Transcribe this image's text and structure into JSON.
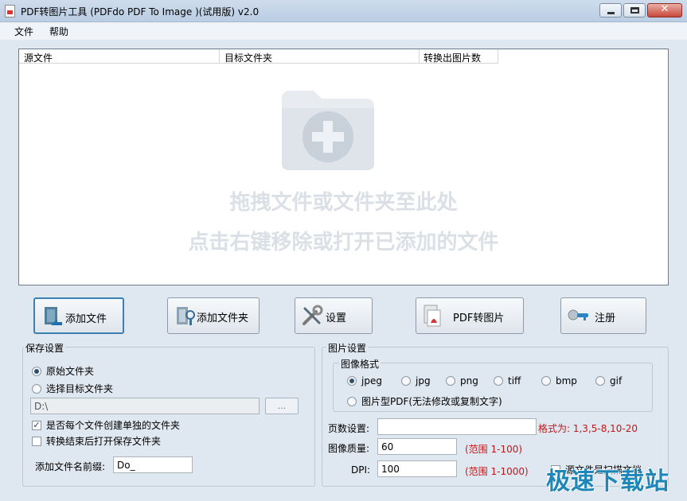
{
  "window": {
    "title": "PDF转图片工具 (PDFdo PDF To Image )(试用版) v2.0",
    "close_glyph": "✕"
  },
  "menu": [
    {
      "label": "文件"
    },
    {
      "label": "帮助"
    }
  ],
  "list": {
    "columns": [
      "源文件",
      "目标文件夹",
      "转换出图片数"
    ],
    "hint_line1": "拖拽文件或文件夹至此处",
    "hint_line2": "点击右键移除或打开已添加的文件"
  },
  "buttons": {
    "add_file": "添加文件",
    "add_folder": "添加文件夹",
    "settings": "设置",
    "pdf_to_image": "PDF转图片",
    "register": "注册"
  },
  "save_settings": {
    "title": "保存设置",
    "option_original": "原始文件夹",
    "option_target": "选择目标文件夹",
    "selected": "original",
    "path_value": "D:\\",
    "browse_label": "...",
    "separate_folder_label": "是否每个文件创建单独的文件夹",
    "separate_folder_checked": true,
    "open_after_label": "转换结束后打开保存文件夹",
    "open_after_checked": false,
    "prefix_label": "添加文件名前缀:",
    "prefix_value": "Do_"
  },
  "image_settings": {
    "title": "图片设置",
    "format_group_title": "图像格式",
    "formats": [
      "jpeg",
      "jpg",
      "png",
      "tiff",
      "bmp",
      "gif"
    ],
    "selected_format": "jpeg",
    "image_pdf_label": "图片型PDF(无法修改或复制文字)",
    "pages_label": "页数设置:",
    "pages_value": "",
    "pages_format_hint": "格式为: 1,3,5-8,10-20",
    "quality_label": "图像质量:",
    "quality_value": "60",
    "quality_range": "(范围 1-100)",
    "dpi_label": "DPI:",
    "dpi_value": "100",
    "dpi_range": "(范围 1-1000)",
    "scanned_label": "源文件是扫描文档",
    "scanned_checked": false
  },
  "watermark": "极速下载站",
  "colors": {
    "accent": "#3c7fb1",
    "hint_text": "#dbe0e6",
    "warning_red": "#c01818",
    "watermark": "#1f86b8"
  }
}
